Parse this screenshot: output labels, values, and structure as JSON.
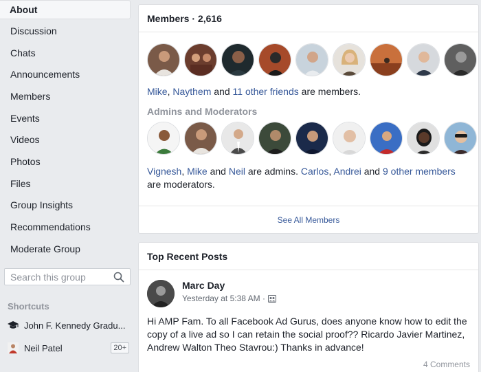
{
  "sidebar": {
    "items": [
      {
        "label": "About"
      },
      {
        "label": "Discussion"
      },
      {
        "label": "Chats"
      },
      {
        "label": "Announcements"
      },
      {
        "label": "Members"
      },
      {
        "label": "Events"
      },
      {
        "label": "Videos"
      },
      {
        "label": "Photos"
      },
      {
        "label": "Files"
      },
      {
        "label": "Group Insights"
      },
      {
        "label": "Recommendations"
      },
      {
        "label": "Moderate Group"
      }
    ],
    "search_placeholder": "Search this group",
    "shortcuts_title": "Shortcuts",
    "shortcuts": [
      {
        "label": "John F. Kennedy Gradu...",
        "icon": "graduation-cap-icon"
      },
      {
        "label": "Neil Patel",
        "badge": "20+",
        "icon": "profile-thumb-icon"
      }
    ]
  },
  "members_card": {
    "title": "Members · 2,616",
    "friends_line": {
      "name1": "Mike",
      "sep": ", ",
      "name2": "Naythem",
      "and": " and ",
      "others": "11 other friends",
      "suffix": " are members."
    },
    "admins_title": "Admins and Moderators",
    "admins_line": {
      "a1": "Vignesh",
      "a2": "Mike",
      "a3": "Neil",
      "admins_suffix": " are admins. ",
      "m1": "Carlos",
      "m2": "Andrei",
      "m_others": "9 other members",
      "mods_suffix": " are moderators.",
      "sep": ", ",
      "and": " and "
    },
    "see_all": "See All Members"
  },
  "posts_card": {
    "title": "Top Recent Posts",
    "post": {
      "author": "Marc Day",
      "time": "Yesterday at 5:38 AM ·",
      "body": "Hi AMP Fam. To all Facebook Ad Gurus, does anyone know how to edit the copy of a live ad so I can retain the social proof?? Ricardo Javier Martinez, Andrew Walton Theo Stavrou:) Thanks in advance!",
      "comments": "4 Comments"
    }
  },
  "colors": {
    "link": "#365899",
    "background": "#e9ebee",
    "muted": "#90949c"
  }
}
